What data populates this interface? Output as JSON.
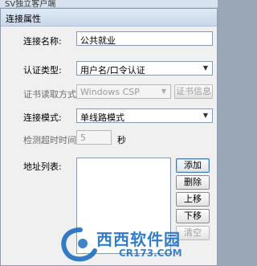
{
  "background_title": "SV独立客户端",
  "dialog": {
    "title": "连接属性"
  },
  "form": {
    "name_label": "连接名称:",
    "name_value": "公共就业",
    "auth_label": "认证类型:",
    "auth_value": "用户名/口令认证",
    "cert_method_label": "证书读取方式:",
    "cert_method_value": "Windows CSP",
    "cert_info_button": "证书信息",
    "mode_label": "连接模式:",
    "mode_value": "单线路模式",
    "timeout_label": "检测超时时间:",
    "timeout_value": "5",
    "timeout_unit": "秒",
    "address_label": "地址列表:"
  },
  "buttons": {
    "add": "添加",
    "delete": "删除",
    "up": "上移",
    "down": "下移",
    "clear": "清空"
  },
  "watermark": {
    "site": "西西软件园",
    "url": "CR173.COM"
  },
  "colors": {
    "watermark_blue": "#1e6fc0",
    "field_border": "#7f9db9"
  }
}
